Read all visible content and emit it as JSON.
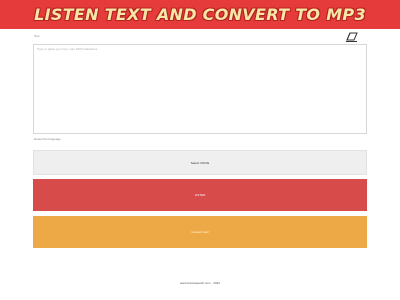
{
  "header": {
    "title": "Listen Text and Convert to MP3"
  },
  "text_field": {
    "label": "Text",
    "placeholder": "Type or paste your text, max 1000 characters",
    "value": ""
  },
  "eraser": {
    "icon": "eraser-icon"
  },
  "language": {
    "label": "Detect the language"
  },
  "buttons": {
    "voice": "Select VOICE",
    "listen": "LISTEN",
    "convert": "Convert mp3"
  },
  "footer": {
    "text": "www.texttospeech.com · 2022"
  },
  "colors": {
    "header_bg": "#e63b3b",
    "header_text": "#f7e7a6",
    "listen_bg": "#d84b4b",
    "convert_bg": "#eda945",
    "voice_bg": "#efefef"
  }
}
